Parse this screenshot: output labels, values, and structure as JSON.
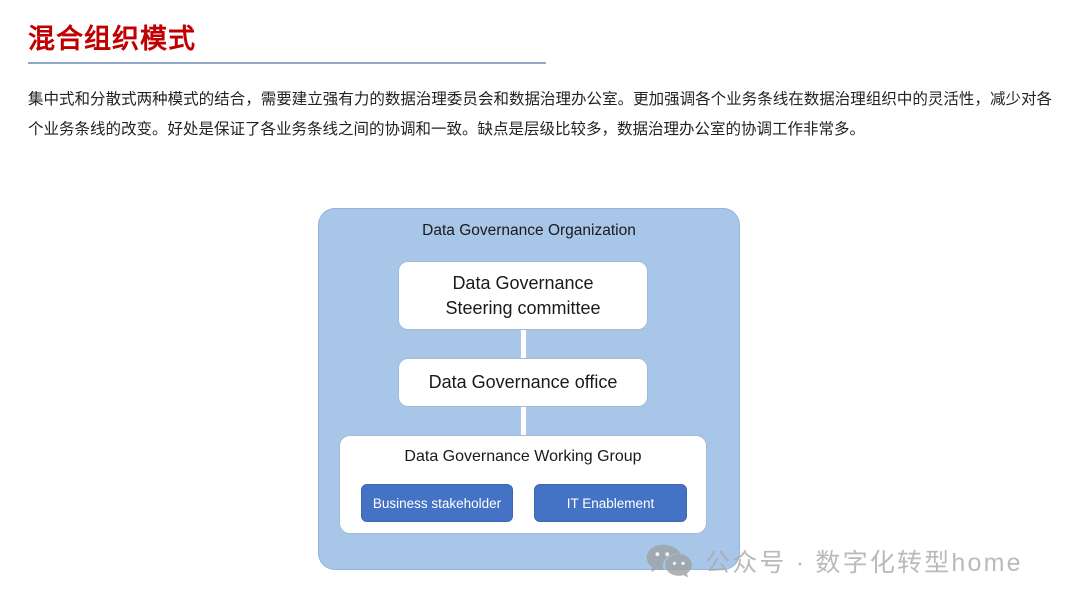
{
  "slide": {
    "title": "混合组织模式",
    "body": "集中式和分散式两种模式的结合，需要建立强有力的数据治理委员会和数据治理办公室。更加强调各个业务条线在数据治理组织中的灵活性，减少对各个业务条线的改变。好处是保证了各业务条线之间的协调和一致。缺点是层级比较多，数据治理办公室的协调工作非常多。"
  },
  "colors": {
    "title": "#C00000",
    "title_rule": "#8FA8C8",
    "panel_fill": "#A8C6E8",
    "panel_border": "#93B4DC",
    "node_fill": "#FFFFFF",
    "node_border": "#A3BBD8",
    "sub_box_fill": "#4472C4",
    "connector": "#FFFFFF",
    "watermark_text": "#A9ABAE"
  },
  "diagram": {
    "panel_title": "Data Governance Organization",
    "nodes": [
      {
        "id": "steering",
        "label_line1": "Data Governance",
        "label_line2": "Steering committee"
      },
      {
        "id": "office",
        "label": "Data Governance office"
      },
      {
        "id": "working_group",
        "label": "Data Governance Working Group"
      }
    ],
    "sub_boxes": [
      {
        "id": "business",
        "label": "Business stakeholder"
      },
      {
        "id": "it",
        "label": "IT Enablement"
      }
    ]
  },
  "watermark": {
    "icon": "wechat-icon",
    "text": "公众号 · 数字化转型home"
  }
}
